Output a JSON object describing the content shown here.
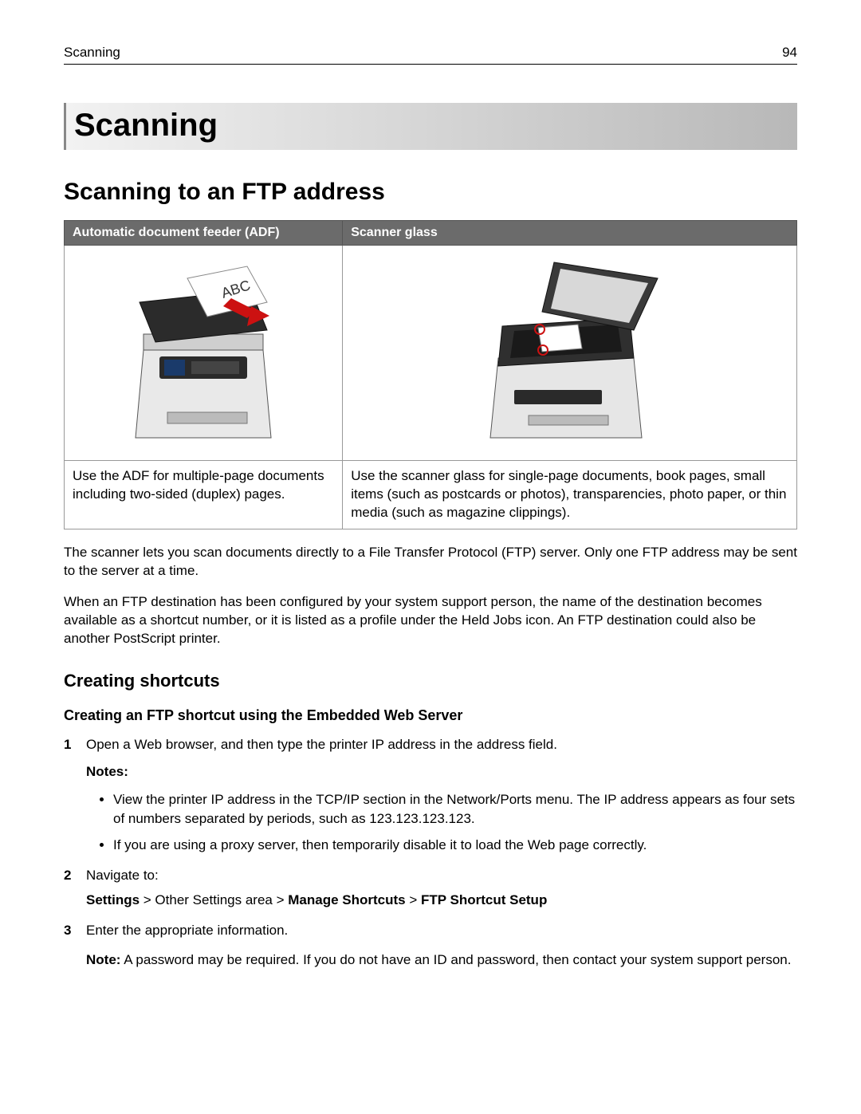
{
  "runhead": {
    "left": "Scanning",
    "right": "94"
  },
  "chapter_title": "Scanning",
  "section_title": "Scanning to an FTP address",
  "table": {
    "headers": [
      "Automatic document feeder (ADF)",
      "Scanner glass"
    ],
    "adf_caption": "Use the ADF for multiple‑page documents including two‑sided (duplex) pages.",
    "glass_caption": "Use the scanner glass for single‑page documents, book pages, small items (such as postcards or photos), transparencies, photo paper, or thin media (such as magazine clippings)."
  },
  "paragraphs": [
    "The scanner lets you scan documents directly to a File Transfer Protocol (FTP) server. Only one FTP address may be sent to the server at a time.",
    "When an FTP destination has been configured by your system support person, the name of the destination becomes available as a shortcut number, or it is listed as a profile under the Held Jobs icon. An FTP destination could also be another PostScript printer."
  ],
  "subsection_title": "Creating shortcuts",
  "subsub_title": "Creating an FTP shortcut using the Embedded Web Server",
  "steps": {
    "s1": "Open a Web browser, and then type the printer IP address in the address field.",
    "notes_label": "Notes:",
    "note_bullets": [
      "View the printer IP address in the TCP/IP section in the Network/Ports menu. The IP address appears as four sets of numbers separated by periods, such as 123.123.123.123.",
      "If you are using a proxy server, then temporarily disable it to load the Web page correctly."
    ],
    "s2": "Navigate to:",
    "nav": {
      "p1": "Settings",
      "p2": " > Other Settings area > ",
      "p3": "Manage Shortcuts",
      "p4": " > ",
      "p5": "FTP Shortcut Setup"
    },
    "s3": "Enter the appropriate information.",
    "s3_note_label": "Note:",
    "s3_note_text": " A password may be required. If you do not have an ID and password, then contact your system support person."
  },
  "icons": {
    "adf": "adf-printer-illustration",
    "glass": "scanner-glass-illustration"
  }
}
